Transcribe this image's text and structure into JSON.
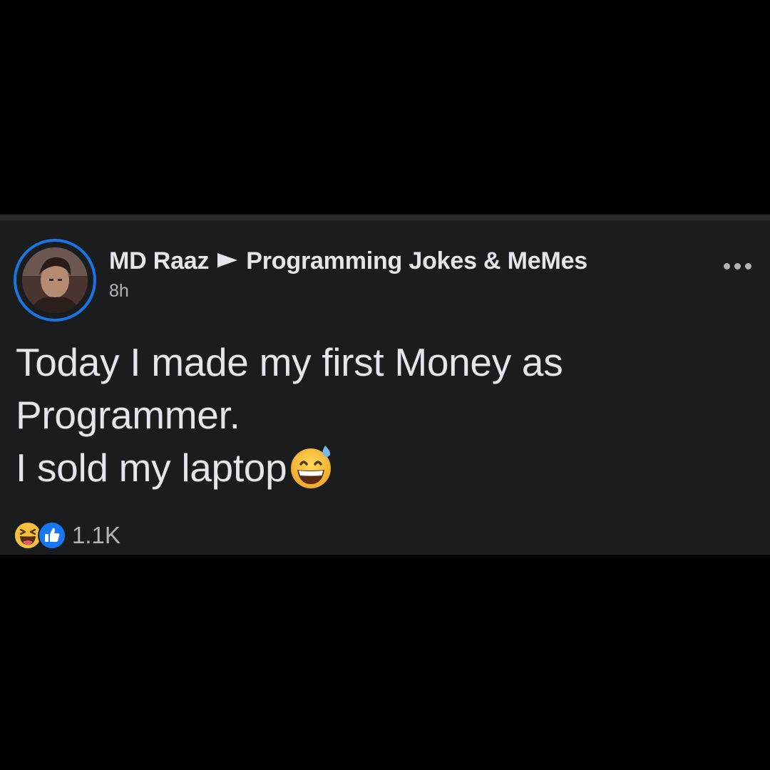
{
  "post": {
    "author": "MD Raaz",
    "group": "Programming Jokes & MeMes",
    "timestamp": "8h",
    "text_line_1": "Today I made my first Money as",
    "text_line_2": "Programmer.",
    "text_line_3": "I sold my laptop",
    "inline_emoji": "grinning-face-with-sweat-icon",
    "reactions": {
      "types": [
        "haha-reaction-icon",
        "like-reaction-icon"
      ],
      "count": "1.1K"
    }
  },
  "colors": {
    "background": "#000000",
    "card": "#1b1c1e",
    "text_primary": "#e4e6eb",
    "text_secondary": "#b0b3b8",
    "avatar_ring": "#1b74e4",
    "like_blue": "#1877f2",
    "emoji_yellow": "#f7c13d"
  }
}
